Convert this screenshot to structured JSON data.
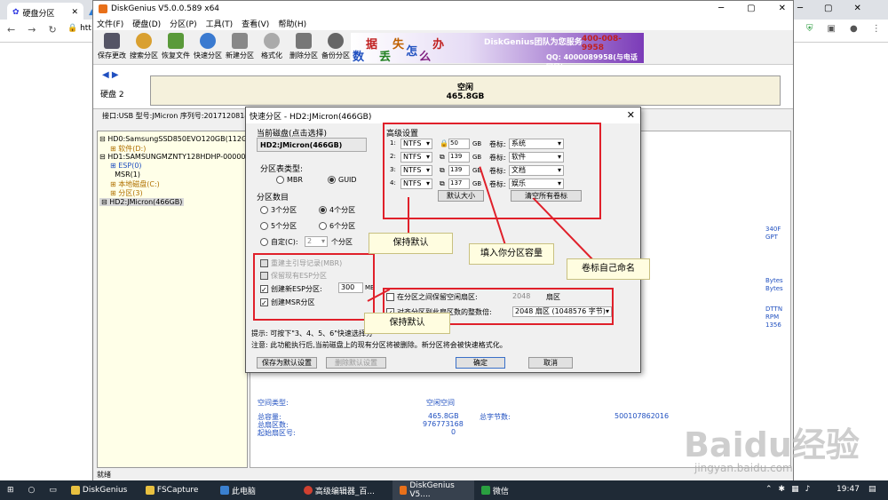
{
  "browser": {
    "tabs": [
      {
        "label": "硬盘分区"
      },
      {
        "label": ""
      }
    ],
    "address": "htt"
  },
  "app": {
    "title": "DiskGenius V5.0.0.589 x64",
    "menu": [
      "文件(F)",
      "硬盘(D)",
      "分区(P)",
      "工具(T)",
      "查看(V)",
      "帮助(H)"
    ],
    "toolbar": [
      "保存更改",
      "搜索分区",
      "恢复文件",
      "快速分区",
      "新建分区",
      "格式化",
      "删除分区",
      "备份分区"
    ],
    "banner": {
      "chars": [
        "数",
        "据",
        "丢",
        "失",
        "怎",
        "么",
        "办"
      ],
      "brand": "DiskGenius团队为您服务",
      "phone": "400-008-9958",
      "qq": "QQ: 4000089958(与电话同号)"
    },
    "disk_label": "硬盘 2",
    "disk_bar": {
      "status": "空闲",
      "size": "465.8GB"
    },
    "interface_line": "接口:USB  型号:JMicron  序列号:20171208141",
    "tree": [
      "HD0:SamsungSSD850EVO120GB(112GB",
      "软件(D:)",
      "HD1:SAMSUNGMZNTY128HDHP-00000(1",
      "ESP(0)",
      "MSR(1)",
      "本地磁盘(C:)",
      "分区(3)",
      "HD2:JMicron(466GB)"
    ],
    "right_panel": {
      "edge_texts": [
        "340F",
        "GPT",
        "Bytes",
        "Bytes",
        "DTTN",
        "RPM",
        "1356"
      ],
      "type_label": "空间类型:",
      "type_value": "空闲空间",
      "capacity_label": "总容量:",
      "capacity_value": "465.8GB",
      "sectors_label": "总扇区数:",
      "sectors_value": "976773168",
      "start_label": "起始扇区号:",
      "start_value": "0",
      "bytes_label": "总字节数:",
      "bytes_value": "500107862016"
    },
    "status": "就绪"
  },
  "dialog": {
    "title": "快速分区 - HD2:JMicron(466GB)",
    "close_icon": "✕",
    "current_disk_label": "当前磁盘(点击选择)",
    "current_disk": "HD2:JMicron(466GB)",
    "partition_table_label": "分区表类型:",
    "mbr": "MBR",
    "guid": "GUID",
    "count_label": "分区数目",
    "counts": [
      "3个分区",
      "4个分区",
      "5个分区",
      "6个分区"
    ],
    "custom_label": "自定(C):",
    "custom_value": "2",
    "custom_unit": "个分区",
    "rebuild_mbr": "重建主引导记录(MBR)",
    "keep_esp": "保留现有ESP分区",
    "create_esp": "创建新ESP分区:",
    "esp_size": "300",
    "esp_unit": "MB",
    "create_msr": "创建MSR分区",
    "advanced_label": "高级设置",
    "rows": [
      {
        "index": "1:",
        "fs": "NTFS",
        "size": "50",
        "unit": "GB",
        "vol_label": "卷标:",
        "vol": "系统"
      },
      {
        "index": "2:",
        "fs": "NTFS",
        "size": "139",
        "unit": "GB",
        "vol_label": "卷标:",
        "vol": "软件"
      },
      {
        "index": "3:",
        "fs": "NTFS",
        "size": "139",
        "unit": "GB",
        "vol_label": "卷标:",
        "vol": "文档"
      },
      {
        "index": "4:",
        "fs": "NTFS",
        "size": "137",
        "unit": "GB",
        "vol_label": "卷标:",
        "vol": "娱乐"
      }
    ],
    "default_size_btn": "默认大小",
    "clear_labels_btn": "清空所有卷标",
    "reserve_label": "在分区之间保留空闲扇区:",
    "reserve_value": "2048",
    "reserve_unit": "扇区",
    "align_label": "对齐分区到此扇区数的整数倍:",
    "align_value": "2048 扇区 (1048576 字节)",
    "hint1": "提示: 可按下\"3、4、5、6\"快速选择分",
    "hint2": "注意: 此功能执行后,当前磁盘上的现有分区将被删除。新分区将会被快速格式化。",
    "save_default_btn": "保存为默认设置",
    "delete_default_btn": "删除默认设置",
    "ok_btn": "确定",
    "cancel_btn": "取消"
  },
  "callouts": {
    "keep_default_1": "保持默认",
    "enter_capacity": "填入你分区容量",
    "name_labels": "卷标自己命名",
    "keep_default_2": "保持默认"
  },
  "watermark": {
    "brand": "Baidu经验",
    "url": "jingyan.baidu.com"
  },
  "taskbar": {
    "items": [
      "DiskGenius",
      "FSCapture",
      "此电脑",
      "高级编辑器_百...",
      "DiskGenius V5....",
      "微信"
    ],
    "time": "19:47"
  }
}
